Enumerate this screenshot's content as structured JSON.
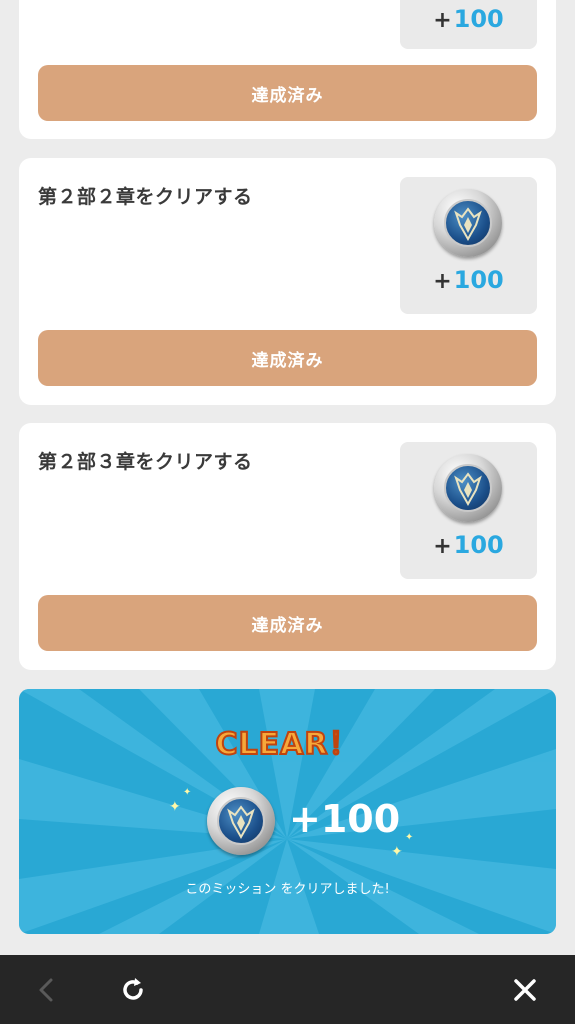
{
  "missions": [
    {
      "title": "",
      "reward": "100",
      "status": "達成済み"
    },
    {
      "title": "第２部２章をクリアする",
      "reward": "100",
      "status": "達成済み"
    },
    {
      "title": "第２部３章をクリアする",
      "reward": "100",
      "status": "達成済み"
    }
  ],
  "reward_plus": "+",
  "clear_banner": {
    "title": "CLEAR！",
    "amount": "+100",
    "message": "このミッション をクリアしました!"
  },
  "toolbar": {
    "back_icon": "chevron-left-icon",
    "reload_icon": "reload-icon",
    "close_icon": "close-icon"
  },
  "colors": {
    "button": "#d9a47c",
    "reward_text": "#2aa8e0",
    "banner": "#29a8d4",
    "toolbar": "#262626"
  }
}
